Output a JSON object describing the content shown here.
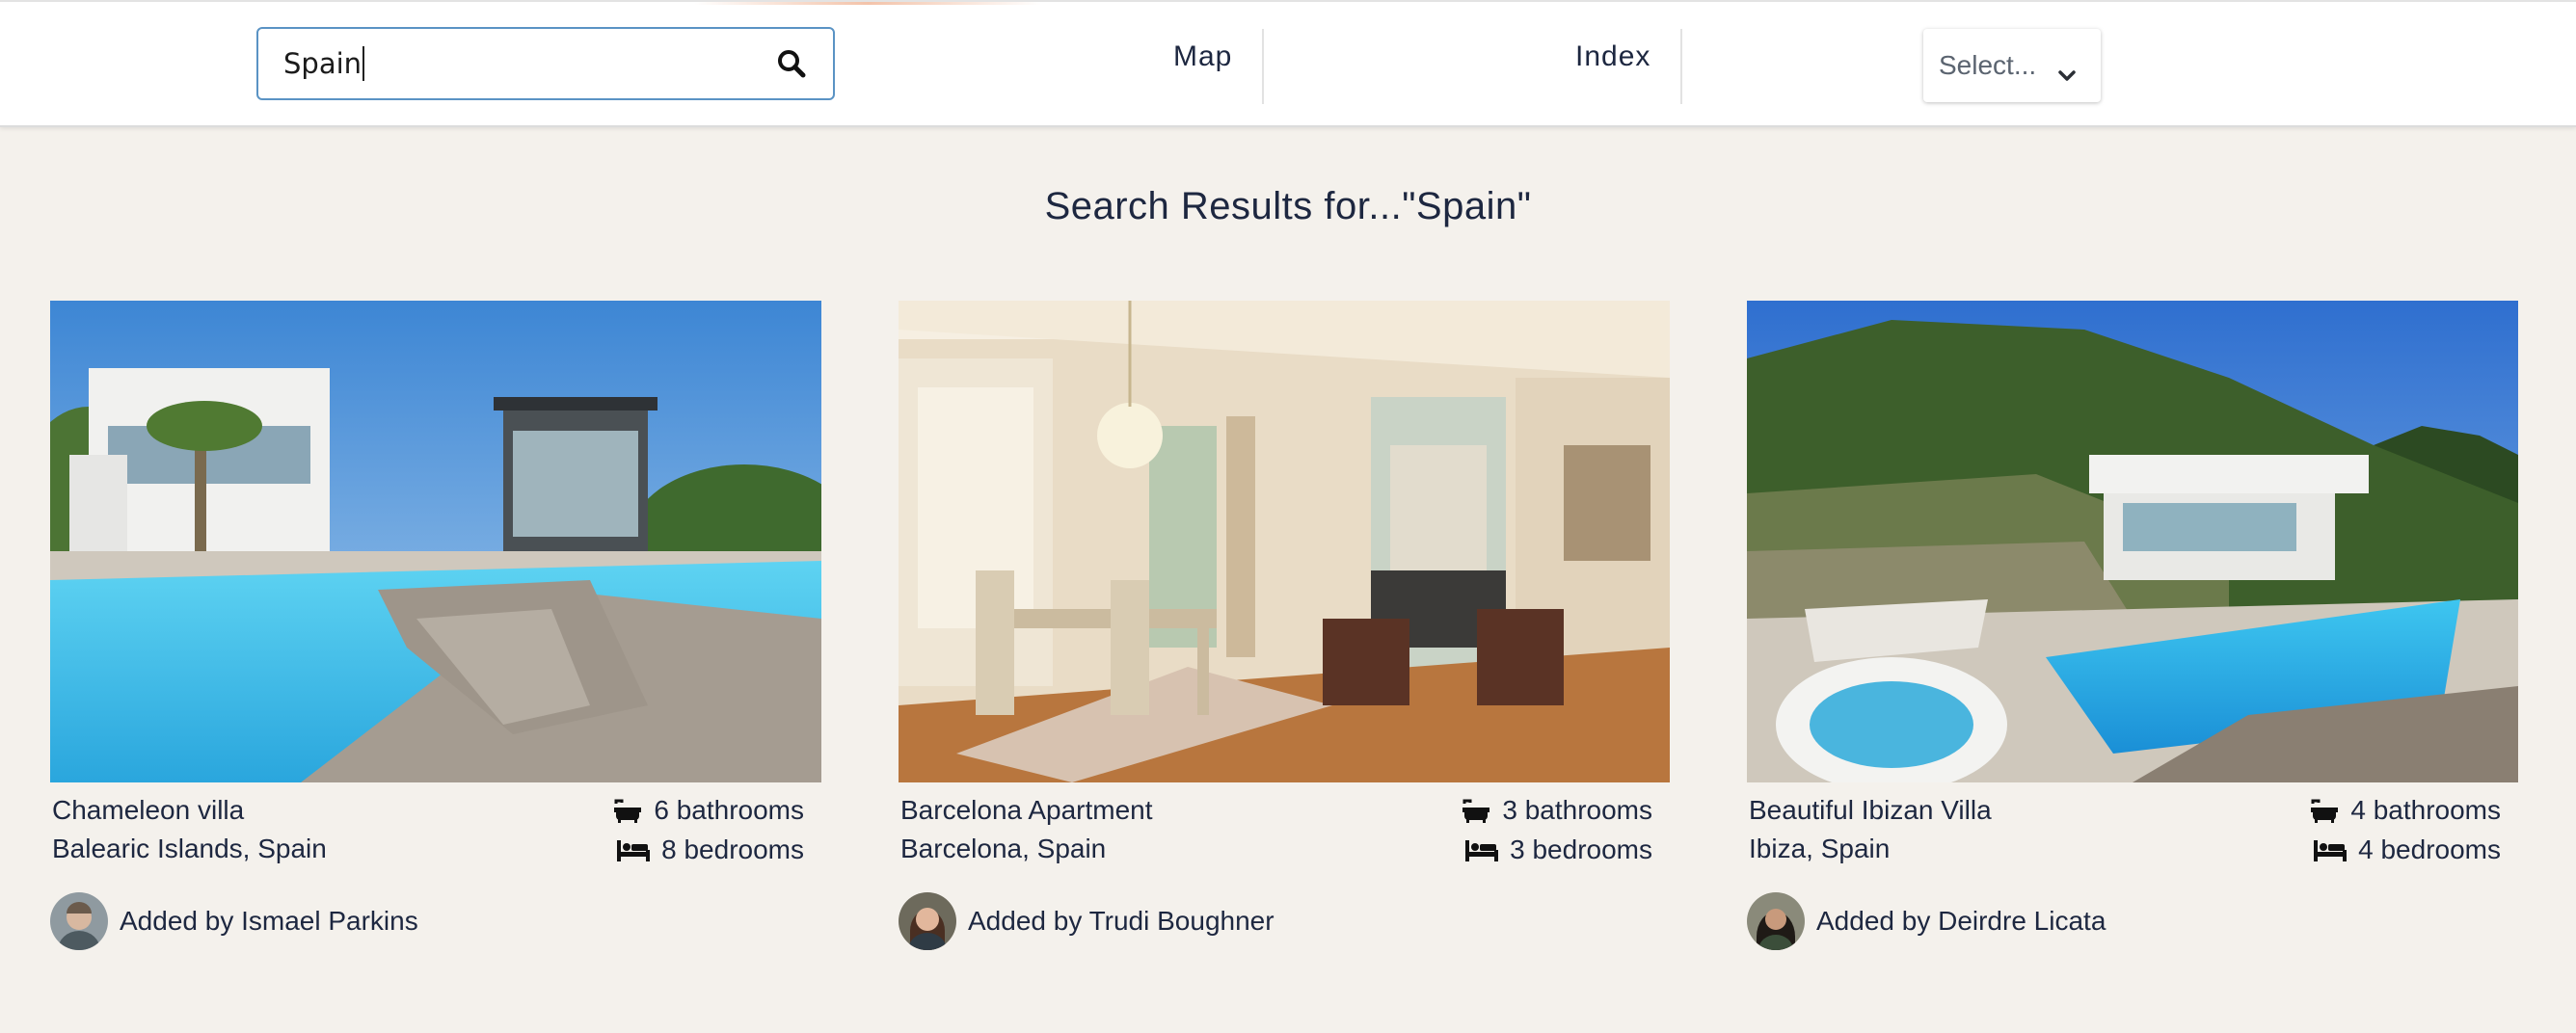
{
  "header": {
    "search": {
      "value": "Spain",
      "placeholder": ""
    },
    "nav": [
      {
        "label": "Map"
      },
      {
        "label": "Index"
      }
    ],
    "select": {
      "selected": "Select..."
    }
  },
  "results": {
    "title": "Search Results for...\"Spain\""
  },
  "listings": [
    {
      "name": "Chameleon villa",
      "location": "Balearic Islands, Spain",
      "bathrooms": "6 bathrooms",
      "bedrooms": "8 bedrooms",
      "added_by": "Added by Ismael Parkins"
    },
    {
      "name": "Barcelona Apartment",
      "location": "Barcelona, Spain",
      "bathrooms": "3 bathrooms",
      "bedrooms": "3 bedrooms",
      "added_by": "Added by Trudi Boughner"
    },
    {
      "name": "Beautiful Ibizan Villa",
      "location": "Ibiza, Spain",
      "bathrooms": "4 bathrooms",
      "bedrooms": "4 bedrooms",
      "added_by": "Added by Deirdre Licata"
    }
  ],
  "icons": {
    "search": "search-icon",
    "chevron": "chevron-down-icon",
    "bath": "bathtub-icon",
    "bed": "bed-icon"
  },
  "colors": {
    "page_background": "#f4f1ec",
    "header_background": "#ffffff",
    "search_border": "#5a93c4",
    "text": "#1d2740"
  }
}
